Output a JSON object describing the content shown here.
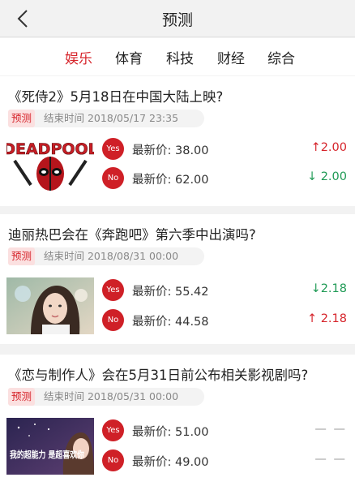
{
  "nav": {
    "title": "预测"
  },
  "tabs": [
    "娱乐",
    "体育",
    "科技",
    "财经",
    "综合"
  ],
  "colors": {
    "accent": "#d6242b",
    "up": "#d6242b",
    "down": "#1f9a55"
  },
  "cards": [
    {
      "question": "《死侍2》5月18日在中国大陆上映?",
      "badge": "预测",
      "end_time": "结束时间 2018/05/17 23:35",
      "thumb_text": "DEADPOOL",
      "yes": {
        "label": "Yes",
        "price": "最新价:  38.00",
        "change": "↑2.00",
        "dir": "up"
      },
      "no": {
        "label": "No",
        "price": "最新价:  62.00",
        "change": "↓ 2.00",
        "dir": "down"
      }
    },
    {
      "question": "迪丽热巴会在《奔跑吧》第六季中出演吗?",
      "badge": "预测",
      "end_time": "结束时间 2018/08/31 00:00",
      "yes": {
        "label": "Yes",
        "price": "最新价:  55.42",
        "change": "↓2.18",
        "dir": "down"
      },
      "no": {
        "label": "No",
        "price": "最新价:  44.58",
        "change": "↑ 2.18",
        "dir": "up"
      }
    },
    {
      "question": "《恋与制作人》会在5月31日前公布相关影视剧吗?",
      "badge": "预测",
      "end_time": "结束时间 2018/05/31 00:00",
      "thumb_text": "我的超能力 是超喜欢你",
      "yes": {
        "label": "Yes",
        "price": "最新价:  51.00",
        "change": "— —",
        "dir": "flat"
      },
      "no": {
        "label": "No",
        "price": "最新价:  49.00",
        "change": "— —",
        "dir": "flat"
      }
    }
  ]
}
